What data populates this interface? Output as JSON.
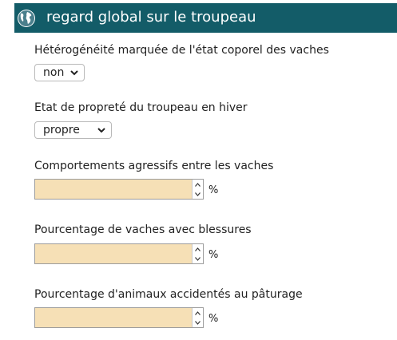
{
  "section": {
    "title": "regard global sur le troupeau",
    "icon": "globe-icon",
    "header_color": "#135c68"
  },
  "fields": [
    {
      "label": "Hétérogénéité marquée de l'état coporel des vaches",
      "type": "select",
      "value": "non"
    },
    {
      "label": "Etat de propreté du troupeau en hiver",
      "type": "select",
      "value": "propre"
    },
    {
      "label": "Comportements agressifs entre les vaches",
      "type": "number",
      "value": "",
      "unit": "%"
    },
    {
      "label": "Pourcentage de vaches avec blessures",
      "type": "number",
      "value": "",
      "unit": "%"
    },
    {
      "label": "Pourcentage d'animaux accidentés au pâturage",
      "type": "number",
      "value": "",
      "unit": "%"
    }
  ],
  "input_fill_color": "#f6e0b6"
}
